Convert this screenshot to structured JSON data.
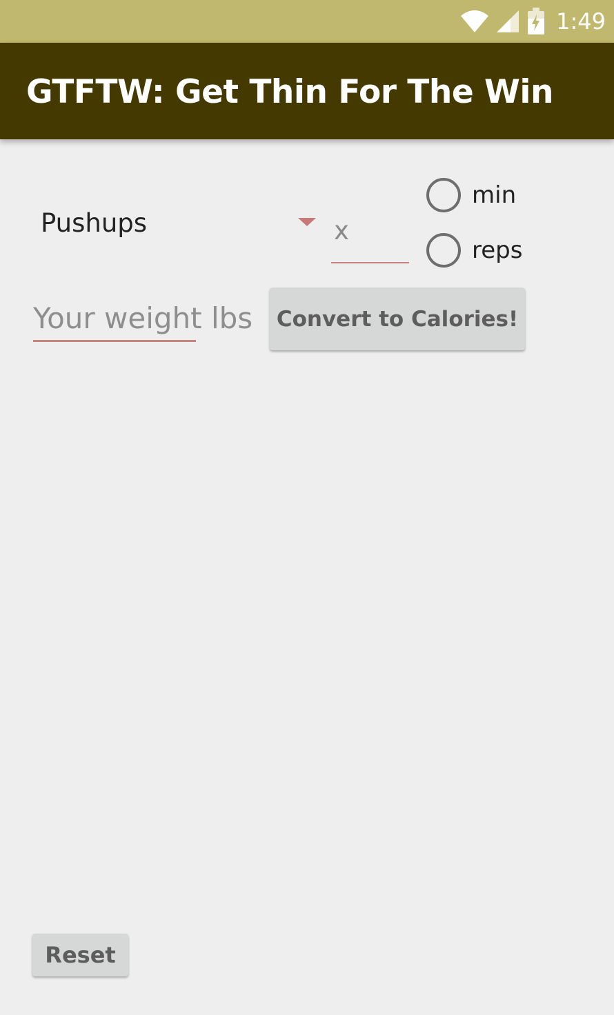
{
  "status_bar": {
    "time": "1:49",
    "icons": [
      "wifi-icon",
      "signal-icon",
      "battery-charging-icon"
    ],
    "background": "#c1b86f"
  },
  "app_bar": {
    "title": "GTFTW: Get Thin For The Win",
    "background": "#443900"
  },
  "form": {
    "exercise_spinner": {
      "selected": "Pushups"
    },
    "amount_field": {
      "value": "",
      "placeholder": "x"
    },
    "unit_options": [
      {
        "label": "min",
        "checked": false
      },
      {
        "label": "reps",
        "checked": false
      }
    ],
    "weight_field": {
      "value": "",
      "placeholder": "Your weight lbs"
    },
    "convert_button_label": "Convert to Calories!",
    "reset_button_label": "Reset"
  },
  "colors": {
    "accent_underline": "#c88580",
    "button_bg": "#d6d7d7",
    "screen_bg": "#eeeeee"
  }
}
